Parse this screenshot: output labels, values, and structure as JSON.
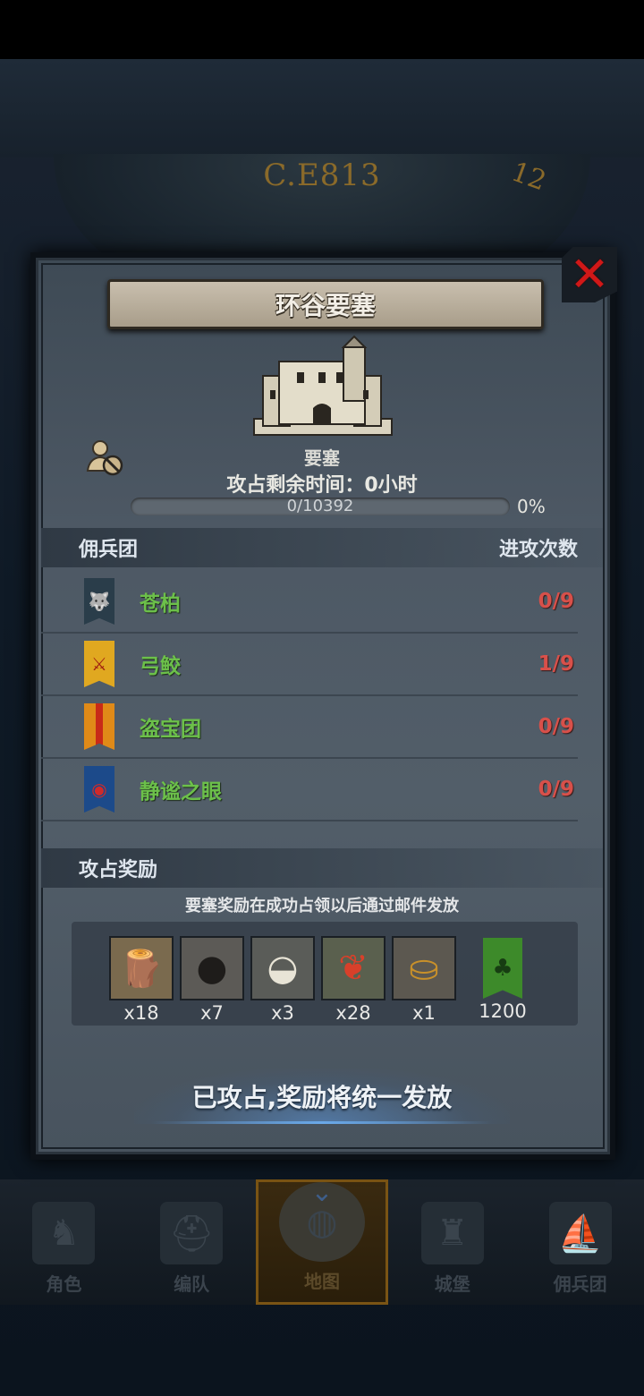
{
  "background": {
    "year_text": "C.E813",
    "clock_number": "12"
  },
  "dialog": {
    "title": "环谷要塞",
    "building_type": "要塞",
    "time_label": "攻占剩余时间：0小时",
    "progress": {
      "text": "0/10392",
      "current": 0,
      "total": 10392,
      "percent_label": "0%"
    },
    "mercenary_section": {
      "header_left": "佣兵团",
      "header_right": "进攻次数",
      "items": [
        {
          "name": "苍柏",
          "count": "0/9",
          "banner_color": "#2a3d4a",
          "emblem": "wolf-emblem"
        },
        {
          "name": "弓鲛",
          "count": "1/9",
          "banner_color": "#e0a820",
          "emblem": "sword-emblem"
        },
        {
          "name": "盗宝团",
          "count": "0/9",
          "banner_color": "#e08a18",
          "emblem": "stripe-emblem"
        },
        {
          "name": "静谧之眼",
          "count": "0/9",
          "banner_color": "#1c4a8a",
          "emblem": "eye-emblem"
        }
      ]
    },
    "reward_section": {
      "header": "攻占奖励",
      "note": "要塞奖励在成功占领以后通过邮件发放",
      "items": [
        {
          "icon": "wood-icon",
          "qty": "x18"
        },
        {
          "icon": "truffle-icon",
          "qty": "x7"
        },
        {
          "icon": "salt-bowl-icon",
          "qty": "x3"
        },
        {
          "icon": "berries-icon",
          "qty": "x28"
        },
        {
          "icon": "helmet-coin-icon",
          "qty": "x1"
        },
        {
          "icon": "tree-banner-icon",
          "qty": "1200"
        }
      ]
    },
    "status_button": "已攻占,奖励将统一发放"
  },
  "bottom_nav": [
    {
      "label": "角色",
      "icon": "knight-icon"
    },
    {
      "label": "编队",
      "icon": "helmet-icon"
    },
    {
      "label": "地图",
      "icon": "globe-icon",
      "active": true
    },
    {
      "label": "城堡",
      "icon": "castle-icon"
    },
    {
      "label": "佣兵团",
      "icon": "ship-icon"
    }
  ],
  "colors": {
    "name_green": "#6cc04a",
    "count_red": "#d8504a",
    "close_red": "#d01818"
  }
}
